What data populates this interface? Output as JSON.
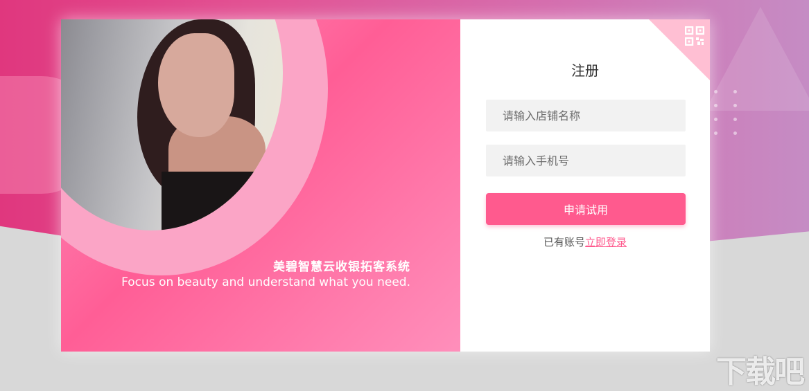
{
  "left_panel": {
    "slogan_cn": "美碧智慧云收银拓客系统",
    "slogan_en": "Focus on beauty and understand what you need."
  },
  "register": {
    "title": "注册",
    "store_name_placeholder": "请输入店铺名称",
    "phone_placeholder": "请输入手机号",
    "submit_label": "申请试用",
    "has_account_text": "已有账号",
    "login_link": "立即登录",
    "qr_icon": "qr-code-icon"
  },
  "watermark": {
    "text": "下载吧"
  },
  "colors": {
    "accent": "#ff5a8e",
    "left_panel": "#ff6b9c",
    "corner": "#ffbfd3"
  }
}
